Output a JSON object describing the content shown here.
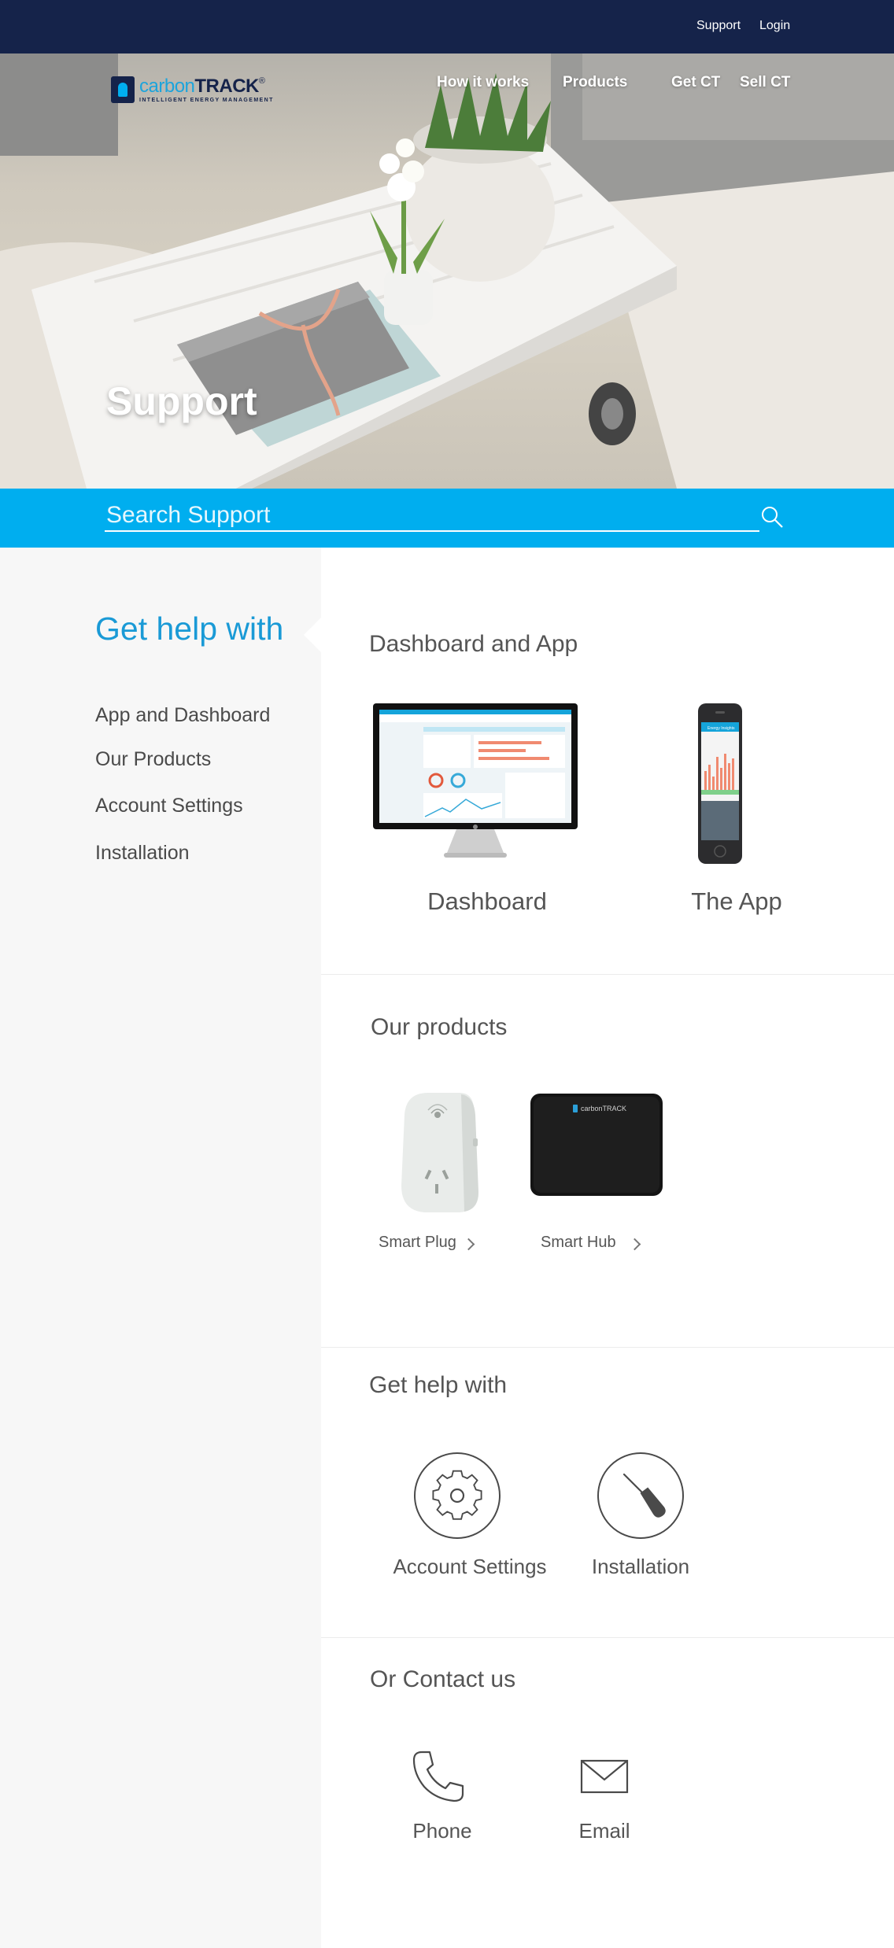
{
  "topbar": {
    "support": "Support",
    "login": "Login"
  },
  "brand": {
    "word_carbon": "carbon",
    "word_track": "TRACK",
    "registered": "®",
    "tagline": "INTELLIGENT ENERGY MANAGEMENT"
  },
  "nav": {
    "how": "How it works",
    "products": "Products",
    "get": "Get CT",
    "sell": "Sell CT"
  },
  "hero": {
    "title": "Support"
  },
  "search": {
    "placeholder": "Search Support"
  },
  "sidebar": {
    "title": "Get help with",
    "items": [
      "App and Dashboard",
      "Our Products",
      "Account Settings",
      "Installation"
    ]
  },
  "dashboard_app": {
    "title": "Dashboard and App",
    "dashboard_label": "Dashboard",
    "app_label": "The App",
    "screen_text": {
      "app_header": "Energy Insights"
    }
  },
  "products": {
    "title": "Our products",
    "plug_label": "Smart Plug",
    "hub_label": "Smart Hub",
    "hub_brand": "carbonTRACK"
  },
  "help": {
    "title": "Get help with",
    "account_label": "Account Settings",
    "install_label": "Installation"
  },
  "contact": {
    "title": "Or Contact us",
    "phone_label": "Phone",
    "email_label": "Email"
  },
  "colors": {
    "navy": "#15234a",
    "accent": "#00aeef",
    "sidebar_title": "#1a9ad6"
  }
}
